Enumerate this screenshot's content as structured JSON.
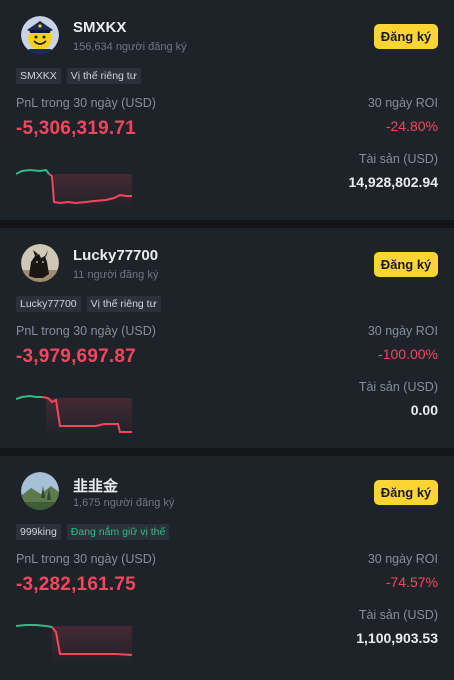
{
  "labels": {
    "pnl": "PnL trong 30 ngày (USD)",
    "roi": "30 ngày ROI",
    "assets": "Tài sản (USD)",
    "follow": "Đăng ký"
  },
  "colors": {
    "accent": "#fcd535",
    "negative": "#f6465d",
    "positive": "#2ebd85"
  },
  "traders": [
    {
      "name": "SMXKX",
      "subscribers": "156,634 người đăng ký",
      "tag1": "SMXKX",
      "tag2": "Vị thế riêng tư",
      "pnl": "-5,306,319.71",
      "roi": "-24.80%",
      "assets": "14,928,802.94",
      "avatar_icon": "smiley-police-avatar"
    },
    {
      "name": "Lucky77700",
      "subscribers": "11 người đăng ký",
      "tag1": "Lucky77700",
      "tag2": "Vị thế riêng tư",
      "pnl": "-3,979,697.87",
      "roi": "-100.00%",
      "assets": "0.00",
      "avatar_icon": "dog-photo-avatar"
    },
    {
      "name": "韭韭金",
      "subscribers": "1,675 người đăng ký",
      "tag1": "999king",
      "tag2": "Đang nắm giữ vị thế",
      "pnl": "-3,282,161.75",
      "roi": "-74.57%",
      "assets": "1,100,903.53",
      "avatar_icon": "landscape-photo-avatar"
    }
  ]
}
